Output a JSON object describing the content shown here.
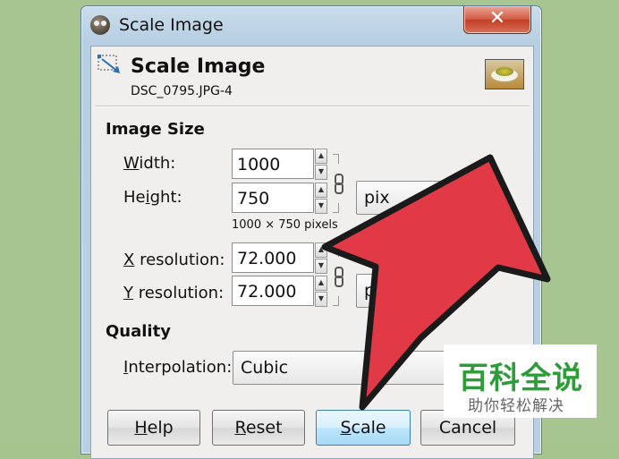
{
  "window": {
    "title": "Scale Image",
    "close_glyph": "✕"
  },
  "header": {
    "title": "Scale Image",
    "subtitle": "DSC_0795.JPG-4"
  },
  "image_size": {
    "section_label": "Image Size",
    "width_label_u": "W",
    "width_label_rest": "idth:",
    "width_value": "1000",
    "height_label_pre": "He",
    "height_label_u": "i",
    "height_label_rest": "ght:",
    "height_value": "750",
    "pixels_note": "1000 × 750 pixels",
    "unit_select": "pix",
    "xres_label_u": "X",
    "xres_label_rest": " resolution:",
    "xres_value": "72.000",
    "yres_label_u": "Y",
    "yres_label_rest": " resolution:",
    "yres_value": "72.000",
    "res_unit_select": "p"
  },
  "quality": {
    "section_label": "Quality",
    "interp_label_u": "I",
    "interp_label_rest": "nterpolation:",
    "interp_value": "Cubic"
  },
  "buttons": {
    "help_u": "H",
    "help_rest": "elp",
    "reset_u": "R",
    "reset_rest": "eset",
    "scale_u": "S",
    "scale_rest": "cale",
    "cancel": "Cancel"
  },
  "watermark": {
    "main": "百科全说",
    "sub": "助你轻松解决"
  },
  "colors": {
    "arrow": "#e13a46",
    "watermark_green": "#2f9c3a",
    "background": "#a6c48e"
  },
  "icons": [
    "gimp-app-icon",
    "close-icon",
    "scale-image-icon",
    "image-thumbnail",
    "chain-link-icon",
    "spin-up-icon",
    "spin-down-icon",
    "dropdown-arrow-icon"
  ]
}
